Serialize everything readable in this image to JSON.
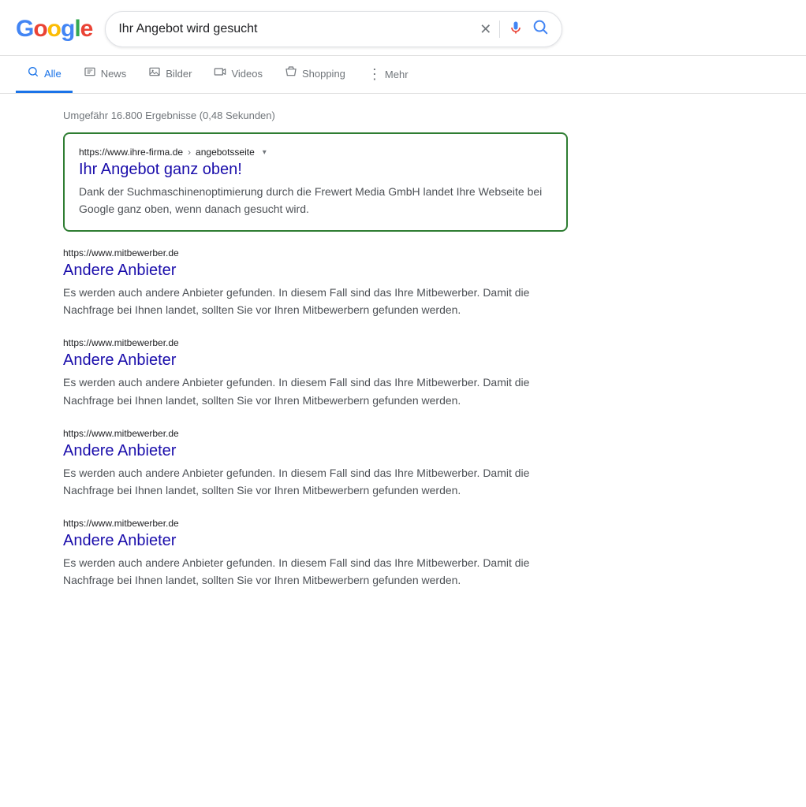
{
  "header": {
    "logo": {
      "g1": "G",
      "o1": "o",
      "o2": "o",
      "g2": "g",
      "l": "l",
      "e": "e"
    },
    "search_query": "Ihr Angebot wird gesucht",
    "clear_title": "Suche löschen",
    "mic_title": "Sprachsuche",
    "search_title": "Google Suche"
  },
  "nav": {
    "tabs": [
      {
        "id": "alle",
        "label": "Alle",
        "icon": "🔍",
        "active": true
      },
      {
        "id": "news",
        "label": "News",
        "icon": "📰",
        "active": false
      },
      {
        "id": "bilder",
        "label": "Bilder",
        "icon": "🖼",
        "active": false
      },
      {
        "id": "videos",
        "label": "Videos",
        "icon": "▶",
        "active": false
      },
      {
        "id": "shopping",
        "label": "Shopping",
        "icon": "◇",
        "active": false
      }
    ],
    "more_label": "Mehr",
    "more_icon": "⋮"
  },
  "results": {
    "count_text": "Umgefähr 16.800 Ergebnisse (0,48 Sekunden)",
    "featured": {
      "url": "https://www.ihre-firma.de",
      "breadcrumb": "angebotsseite",
      "title": "Ihr Angebot ganz oben!",
      "snippet": "Dank der Suchmaschinenoptimierung durch die Frewert Media GmbH landet Ihre Webseite bei Google ganz oben, wenn danach gesucht wird."
    },
    "items": [
      {
        "url": "https://www.mitbewerber.de",
        "title": "Andere Anbieter",
        "snippet": "Es werden auch andere Anbieter gefunden. In diesem Fall sind das Ihre Mitbewerber. Damit die Nachfrage bei Ihnen landet, sollten Sie vor Ihren Mitbewerbern gefunden werden."
      },
      {
        "url": "https://www.mitbewerber.de",
        "title": "Andere Anbieter",
        "snippet": "Es werden auch andere Anbieter gefunden. In diesem Fall sind das Ihre Mitbewerber. Damit die Nachfrage bei Ihnen landet, sollten Sie vor Ihren Mitbewerbern gefunden werden."
      },
      {
        "url": "https://www.mitbewerber.de",
        "title": "Andere Anbieter",
        "snippet": "Es werden auch andere Anbieter gefunden. In diesem Fall sind das Ihre Mitbewerber. Damit die Nachfrage bei Ihnen landet, sollten Sie vor Ihren Mitbewerbern gefunden werden."
      },
      {
        "url": "https://www.mitbewerber.de",
        "title": "Andere Anbieter",
        "snippet": "Es werden auch andere Anbieter gefunden. In diesem Fall sind das Ihre Mitbewerber. Damit die Nachfrage bei Ihnen landet, sollten Sie vor Ihren Mitbewerbern gefunden werden."
      }
    ]
  }
}
